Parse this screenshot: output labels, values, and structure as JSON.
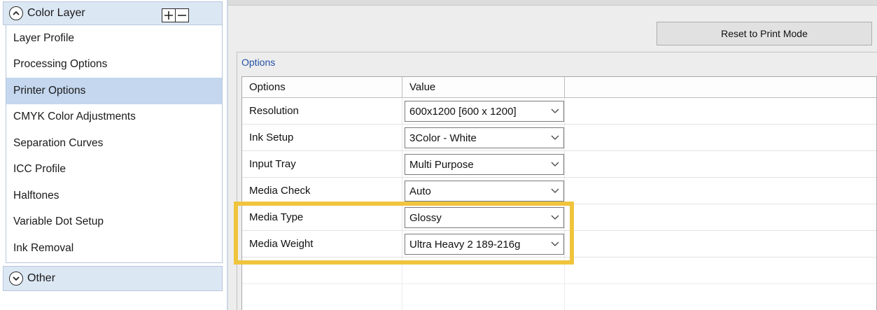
{
  "sidebar": {
    "color_layer": {
      "title": "Color Layer",
      "expanded": true
    },
    "items": [
      {
        "label": "Layer Profile",
        "selected": false
      },
      {
        "label": "Processing Options",
        "selected": false
      },
      {
        "label": "Printer Options",
        "selected": true
      },
      {
        "label": "CMYK Color Adjustments",
        "selected": false
      },
      {
        "label": "Separation Curves",
        "selected": false
      },
      {
        "label": "ICC Profile",
        "selected": false
      },
      {
        "label": "Halftones",
        "selected": false
      },
      {
        "label": "Variable Dot Setup",
        "selected": false
      },
      {
        "label": "Ink Removal",
        "selected": false
      }
    ],
    "other": {
      "title": "Other",
      "expanded": false
    }
  },
  "toolbar": {
    "reset_label": "Reset to Print Mode"
  },
  "options": {
    "group_label": "Options",
    "columns": [
      "Options",
      "Value"
    ],
    "rows": [
      {
        "name": "Resolution",
        "value": "600x1200 [600 x 1200]"
      },
      {
        "name": "Ink Setup",
        "value": "3Color - White"
      },
      {
        "name": "Input Tray",
        "value": "Multi Purpose"
      },
      {
        "name": "Media Check",
        "value": "Auto"
      },
      {
        "name": "Media Type",
        "value": "Glossy"
      },
      {
        "name": "Media Weight",
        "value": "Ultra Heavy 2 189-216g"
      }
    ]
  },
  "colors": {
    "highlight": "#f0c43d",
    "selected_item": "#c4d7ee",
    "group_header": "#dce7f4",
    "accent_text": "#2451a6"
  }
}
